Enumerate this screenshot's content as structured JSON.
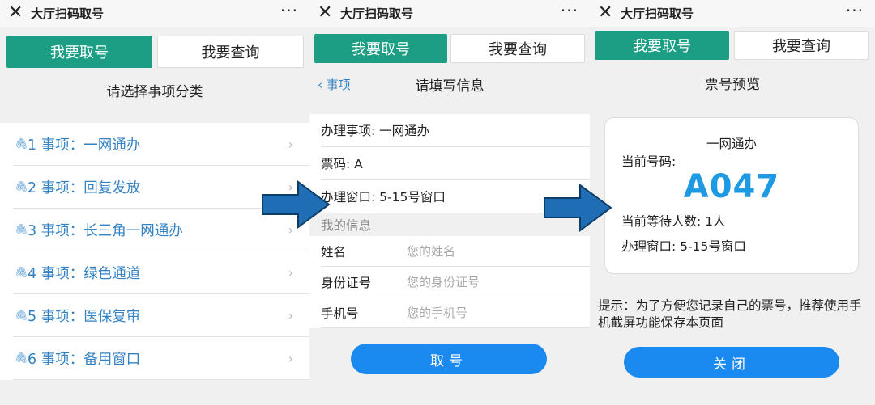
{
  "common": {
    "app_title": "大厅扫码取号",
    "close_glyph": "✕",
    "more_glyph": "···",
    "tab_get": "我要取号",
    "tab_query": "我要查询"
  },
  "screen1": {
    "heading": "请选择事项分类",
    "items": [
      {
        "label": "1 事项：一网通办"
      },
      {
        "label": "2 事项：回复发放"
      },
      {
        "label": "3 事项：长三角一网通办"
      },
      {
        "label": "4 事项：绿色通道"
      },
      {
        "label": "5 事项：医保复审"
      },
      {
        "label": "6 事项：备用窗口"
      }
    ]
  },
  "screen2": {
    "back_label": "事项",
    "heading": "请填写信息",
    "rows": [
      {
        "text": "办理事项: 一网通办"
      },
      {
        "text": "票码: A"
      },
      {
        "text": "办理窗口: 5-15号窗口"
      }
    ],
    "section_label": "我的信息",
    "fields": [
      {
        "label": "姓名",
        "placeholder": "您的姓名"
      },
      {
        "label": "身份证号",
        "placeholder": "您的身份证号"
      },
      {
        "label": "手机号",
        "placeholder": "您的手机号"
      }
    ],
    "submit_label": "取号"
  },
  "screen3": {
    "heading": "票号预览",
    "card_title": "一网通办",
    "current_label": "当前号码:",
    "ticket_number": "A047",
    "waiting_text": "当前等待人数: 1人",
    "window_text": "办理窗口: 5-15号窗口",
    "tip": "提示：为了方便您记录自己的票号，推荐使用手机截屏功能保存本页面",
    "close_label": "关闭"
  },
  "colors": {
    "tab_active": "#1b9e84",
    "link_blue": "#3382c4",
    "button_blue": "#1a8af0",
    "ticket_blue": "#1d9ae3",
    "arrow_blue": "#1f6eb5"
  }
}
